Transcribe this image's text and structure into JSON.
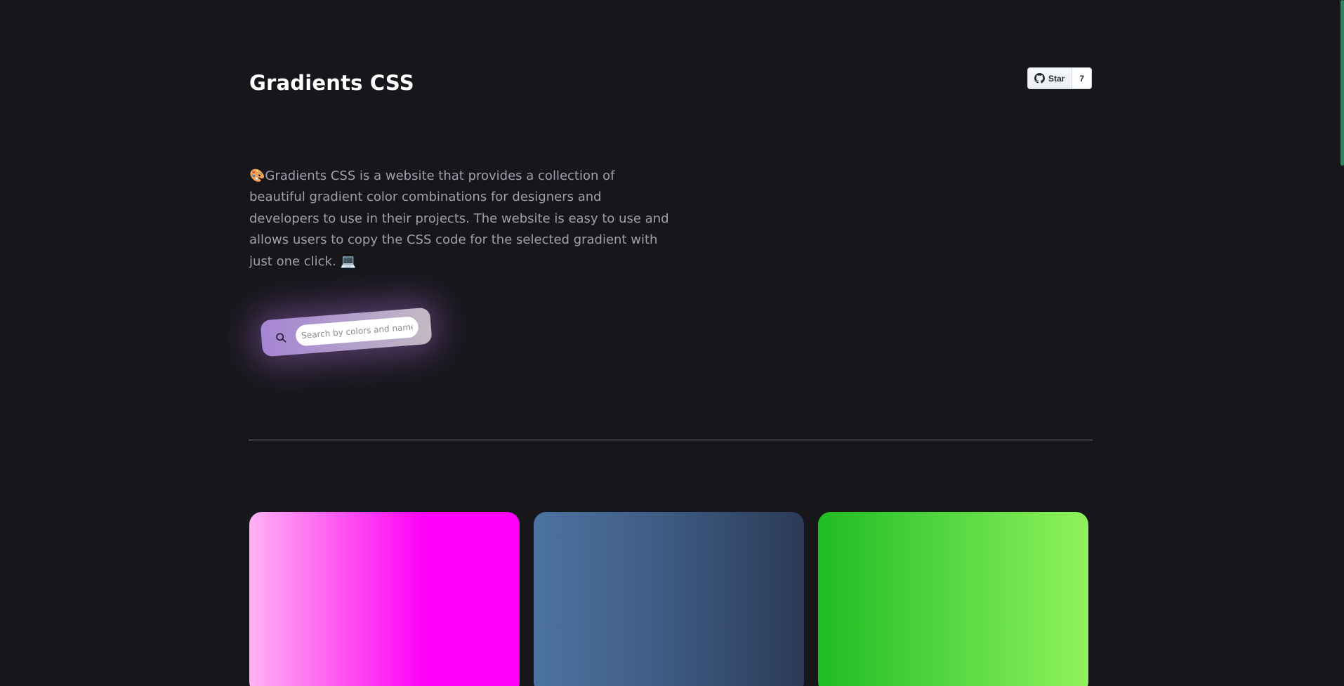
{
  "header": {
    "title": "Gradients CSS",
    "github": {
      "star_label": "Star",
      "star_count": "7"
    }
  },
  "intro": {
    "description": "🎨Gradients CSS is a website that provides a collection of beautiful gradient color combinations for designers and developers to use in their projects. The website is easy to use and allows users to copy the CSS code for the selected gradient with just one click. 💻"
  },
  "search": {
    "placeholder": "Search by colors and name",
    "value": "",
    "icon": "search-icon"
  },
  "colors": {
    "background": "#16161b",
    "scrollbar": "#2b8a5c",
    "description_text": "#9ea0ad"
  },
  "gradients": [
    {
      "id": "gradient-1",
      "colors": [
        "#ffb3f5",
        "#ff52f0",
        "#ff00f8"
      ]
    },
    {
      "id": "gradient-2",
      "colors": [
        "#4d73a1",
        "#3f5d85",
        "#2b3b57"
      ]
    },
    {
      "id": "gradient-3",
      "colors": [
        "#1fbc22",
        "#4bd23c",
        "#91f25c"
      ]
    }
  ]
}
